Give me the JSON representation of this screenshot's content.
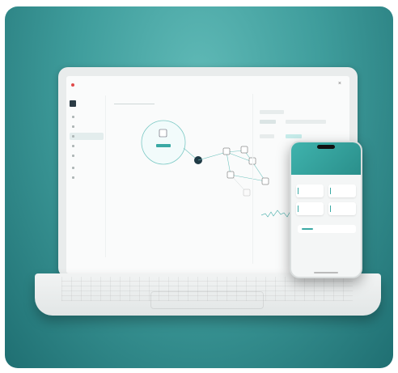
{
  "colors": {
    "card_bg": "#3f9d9c",
    "accent": "#3aa9a4",
    "screen_bg": "#fafbfb",
    "selected_node": "#1f3a45"
  },
  "laptop": {
    "topbar": {
      "brand": "",
      "close_icon": "close-icon"
    },
    "sidebar": {
      "items": [
        {
          "label": "",
          "icon": "home-icon"
        },
        {
          "label": "",
          "icon": "list-icon"
        },
        {
          "label": "",
          "icon": "network-icon"
        },
        {
          "label": "",
          "icon": "device-icon"
        },
        {
          "label": "",
          "icon": "tag-icon"
        },
        {
          "label": "",
          "icon": "settings-icon"
        },
        {
          "label": "",
          "icon": "user-icon"
        }
      ]
    },
    "search": {
      "placeholder": ""
    },
    "network": {
      "root_label": "",
      "nodes": [
        "",
        "",
        "",
        "",
        "",
        ""
      ]
    },
    "right_panel": {
      "tabs": [
        "",
        "",
        "",
        ""
      ]
    }
  },
  "phone": {
    "subtitle": "",
    "title": "",
    "cards": [
      "",
      "",
      "",
      ""
    ]
  }
}
